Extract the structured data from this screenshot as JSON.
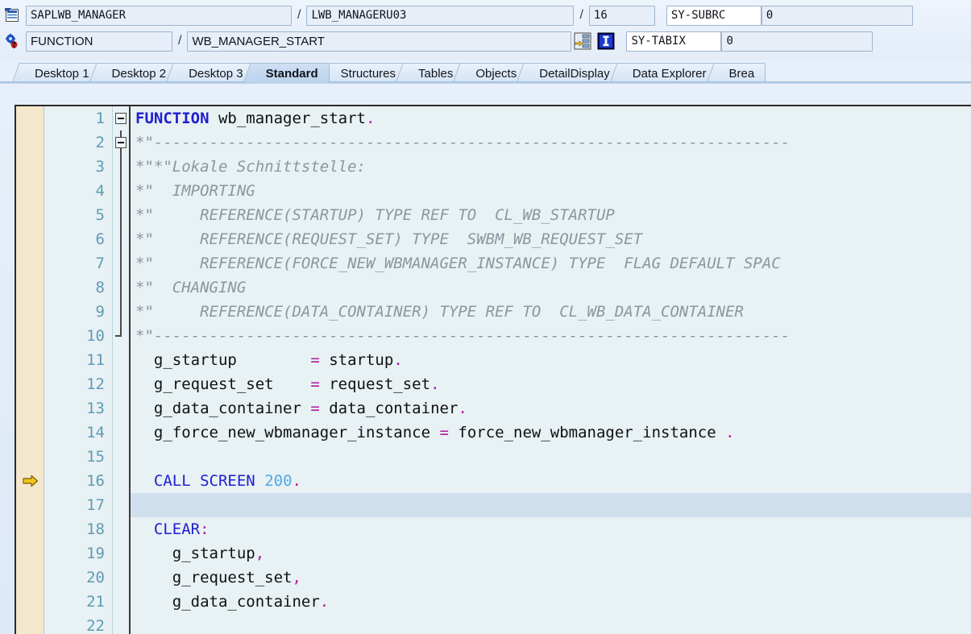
{
  "header": {
    "row1": {
      "program_icon": "program-icon",
      "program": "SAPLWB_MANAGER",
      "separator": "/",
      "include": "LWB_MANAGERU03",
      "separator2": "/",
      "line": "16",
      "sysfield_name": "SY-SUBRC",
      "sysfield_value": "0"
    },
    "row2": {
      "debug_icon": "debugger-bug-icon",
      "event_type": "FUNCTION",
      "separator": "/",
      "event_name": "WB_MANAGER_START",
      "goto_icon": "goto-stack-icon",
      "info_icon": "information-icon",
      "sysfield_name": "SY-TABIX",
      "sysfield_value": "0"
    }
  },
  "tabs": [
    {
      "label": "Desktop 1",
      "active": false
    },
    {
      "label": "Desktop 2",
      "active": false
    },
    {
      "label": "Desktop 3",
      "active": false
    },
    {
      "label": "Standard",
      "active": true
    },
    {
      "label": "Structures",
      "active": false
    },
    {
      "label": "Tables",
      "active": false
    },
    {
      "label": "Objects",
      "active": false
    },
    {
      "label": "DetailDisplay",
      "active": false
    },
    {
      "label": "Data Explorer",
      "active": false
    },
    {
      "label": "Brea",
      "active": false
    }
  ],
  "editor": {
    "current_line": 16,
    "colors": {
      "comment": "#8d95a0",
      "keyword": "#2020cf",
      "number": "#50a8e8",
      "operator": "#b0189f",
      "highlight_row": "#cfdfee",
      "breakpoint_gutter": "#f4e8cc",
      "background": "#e8f1f4",
      "line_number": "#5e9cb5"
    },
    "lines": [
      {
        "n": "1",
        "fold": "box",
        "segs": [
          {
            "t": "FUNCTION",
            "c": "kw bold"
          },
          {
            "t": " wb_manager_start",
            "c": ""
          },
          {
            "t": ".",
            "c": "op"
          }
        ]
      },
      {
        "n": "2",
        "fold": "box2",
        "segs": [
          {
            "t": "*\"---------------------------------------------------------------------",
            "c": "cmt"
          }
        ]
      },
      {
        "n": "3",
        "fold": "line",
        "segs": [
          {
            "t": "*\"*\"Lokale Schnittstelle:",
            "c": "cmt"
          }
        ]
      },
      {
        "n": "4",
        "fold": "line",
        "segs": [
          {
            "t": "*\"  IMPORTING",
            "c": "cmt"
          }
        ]
      },
      {
        "n": "5",
        "fold": "line",
        "segs": [
          {
            "t": "*\"     REFERENCE(STARTUP) TYPE REF TO  CL_WB_STARTUP",
            "c": "cmt"
          }
        ]
      },
      {
        "n": "6",
        "fold": "line",
        "segs": [
          {
            "t": "*\"     REFERENCE(REQUEST_SET) TYPE  SWBM_WB_REQUEST_SET",
            "c": "cmt"
          }
        ]
      },
      {
        "n": "7",
        "fold": "line",
        "segs": [
          {
            "t": "*\"     REFERENCE(FORCE_NEW_WBMANAGER_INSTANCE) TYPE  FLAG DEFAULT SPAC",
            "c": "cmt"
          }
        ]
      },
      {
        "n": "8",
        "fold": "line",
        "segs": [
          {
            "t": "*\"  CHANGING",
            "c": "cmt"
          }
        ]
      },
      {
        "n": "9",
        "fold": "line",
        "segs": [
          {
            "t": "*\"     REFERENCE(DATA_CONTAINER) TYPE REF TO  CL_WB_DATA_CONTAINER",
            "c": "cmt"
          }
        ]
      },
      {
        "n": "10",
        "fold": "tick",
        "segs": [
          {
            "t": "*\"---------------------------------------------------------------------",
            "c": "cmt"
          }
        ]
      },
      {
        "n": "11",
        "fold": "",
        "segs": [
          {
            "t": "  g_startup        ",
            "c": ""
          },
          {
            "t": "=",
            "c": "op"
          },
          {
            "t": " startup",
            "c": ""
          },
          {
            "t": ".",
            "c": "op"
          }
        ]
      },
      {
        "n": "12",
        "fold": "",
        "segs": [
          {
            "t": "  g_request_set    ",
            "c": ""
          },
          {
            "t": "=",
            "c": "op"
          },
          {
            "t": " request_set",
            "c": ""
          },
          {
            "t": ".",
            "c": "op"
          }
        ]
      },
      {
        "n": "13",
        "fold": "",
        "segs": [
          {
            "t": "  g_data_container ",
            "c": ""
          },
          {
            "t": "=",
            "c": "op"
          },
          {
            "t": " data_container",
            "c": ""
          },
          {
            "t": ".",
            "c": "op"
          }
        ]
      },
      {
        "n": "14",
        "fold": "",
        "segs": [
          {
            "t": "  g_force_new_wbmanager_instance ",
            "c": ""
          },
          {
            "t": "=",
            "c": "op"
          },
          {
            "t": " force_new_wbmanager_instance ",
            "c": ""
          },
          {
            "t": ".",
            "c": "op"
          }
        ]
      },
      {
        "n": "15",
        "fold": "",
        "segs": [
          {
            "t": "",
            "c": ""
          }
        ]
      },
      {
        "n": "16",
        "fold": "",
        "marker": true,
        "segs": [
          {
            "t": "  ",
            "c": ""
          },
          {
            "t": "CALL SCREEN",
            "c": "kw"
          },
          {
            "t": " ",
            "c": ""
          },
          {
            "t": "200",
            "c": "num"
          },
          {
            "t": ".",
            "c": "op"
          }
        ]
      },
      {
        "n": "17",
        "fold": "",
        "highlight": true,
        "segs": [
          {
            "t": "",
            "c": ""
          }
        ]
      },
      {
        "n": "18",
        "fold": "",
        "segs": [
          {
            "t": "  ",
            "c": ""
          },
          {
            "t": "CLEAR",
            "c": "kw"
          },
          {
            "t": ":",
            "c": "op"
          }
        ]
      },
      {
        "n": "19",
        "fold": "",
        "segs": [
          {
            "t": "    g_startup",
            "c": ""
          },
          {
            "t": ",",
            "c": "op"
          }
        ]
      },
      {
        "n": "20",
        "fold": "",
        "segs": [
          {
            "t": "    g_request_set",
            "c": ""
          },
          {
            "t": ",",
            "c": "op"
          }
        ]
      },
      {
        "n": "21",
        "fold": "",
        "segs": [
          {
            "t": "    g_data_container",
            "c": ""
          },
          {
            "t": ".",
            "c": "op"
          }
        ]
      },
      {
        "n": "22",
        "fold": "",
        "segs": [
          {
            "t": "",
            "c": ""
          }
        ]
      }
    ]
  }
}
